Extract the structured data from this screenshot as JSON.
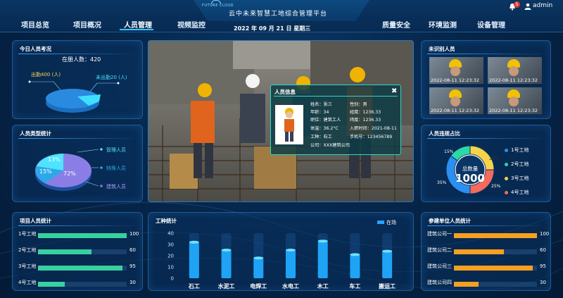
{
  "header": {
    "logo_text": "FUTURE CLOUD",
    "platform_title": "云中未来智慧工地综合管理平台",
    "date_text": "2022 年 09 月 21 日    星期三",
    "nav_left": [
      "项目总览",
      "项目概况",
      "人员管理",
      "视频监控"
    ],
    "nav_right": [
      "质量安全",
      "环境监测",
      "设备管理"
    ],
    "active_nav": "人员管理",
    "notification_count": "5",
    "username": "admin"
  },
  "attendance": {
    "title": "今日人员考况",
    "registered": "在册人数：420",
    "present": "出勤400 (人)",
    "absent": "未出勤20 (人)",
    "present_value": 400,
    "absent_value": 20
  },
  "person_types": {
    "title": "人员类型统计",
    "slices": [
      {
        "label": "管理人员",
        "percent_label": "13%",
        "value": 13,
        "color": "#4ee3ff"
      },
      {
        "label": "特殊人员",
        "percent_label": "15%",
        "value": 15,
        "color": "#2aa9e8"
      },
      {
        "label": "建筑人员",
        "percent_label": "72%",
        "value": 72,
        "color": "#8a7ee6"
      }
    ]
  },
  "popup": {
    "title": "人员信息",
    "close": "✖",
    "name": "姓名：张三",
    "gender": "性别：男",
    "age": "年龄：34",
    "longitude": "经度：1236.33",
    "position": "职位：建筑工人",
    "latitude": "纬度：1236.33",
    "temperature": "体温：36.2°C",
    "entry_time": "入职时间：2021-08-11",
    "trade": "工种：石工",
    "phone": "手机号：123456789",
    "company": "公司：XXX建筑公司"
  },
  "unknown_persons": {
    "title": "未识别人员",
    "timestamps": [
      "2022-08-11  12:23:32",
      "2022-08-11  12:23:32",
      "2022-08-11  12:23:32",
      "2022-08-11  12:23:32"
    ]
  },
  "violations": {
    "title": "人员违规占比",
    "center_label": "总数量",
    "center_value": "1000",
    "slices": [
      {
        "label": "1号工地",
        "percent_label": "25%",
        "value": 25,
        "color": "#f7d447"
      },
      {
        "label": "2号工地",
        "percent_label": "15%",
        "value": 15,
        "color": "#2bd9a6"
      },
      {
        "label": "3号工地",
        "percent_label": "35%",
        "value": 35,
        "color": "#2b8ff0"
      },
      {
        "label": "4号工地",
        "percent_label": "25%",
        "value": 25,
        "color": "#f36b5c"
      }
    ],
    "legend_colors": [
      "#2b8ff0",
      "#2bd9a6",
      "#f7d447",
      "#f36b5c"
    ]
  },
  "project_stats": {
    "title": "项目人员统计",
    "items": [
      {
        "label": "1号工地",
        "value": "100",
        "num": 100
      },
      {
        "label": "2号工地",
        "value": "60",
        "num": 60
      },
      {
        "label": "3号工地",
        "value": "95",
        "num": 95
      },
      {
        "label": "4号工地",
        "value": "30",
        "num": 30
      }
    ],
    "max": 100
  },
  "company_stats": {
    "title": "参建单位人员统计",
    "items": [
      {
        "label": "建筑公司一",
        "value": "100",
        "num": 100
      },
      {
        "label": "建筑公司二",
        "value": "60",
        "num": 60
      },
      {
        "label": "建筑公司三",
        "value": "95",
        "num": 95
      },
      {
        "label": "建筑公司四",
        "value": "30",
        "num": 30
      }
    ],
    "max": 100
  },
  "chart_data": {
    "type": "bar",
    "title": "工种统计",
    "legend": "在场",
    "categories": [
      "石工",
      "水泥工",
      "电焊工",
      "水电工",
      "木工",
      "车工",
      "搬运工"
    ],
    "values": [
      32,
      25,
      18,
      25,
      33,
      21,
      24
    ],
    "ylim": [
      0,
      40
    ],
    "yticks": [
      "0",
      "10",
      "20",
      "30",
      "40"
    ]
  }
}
